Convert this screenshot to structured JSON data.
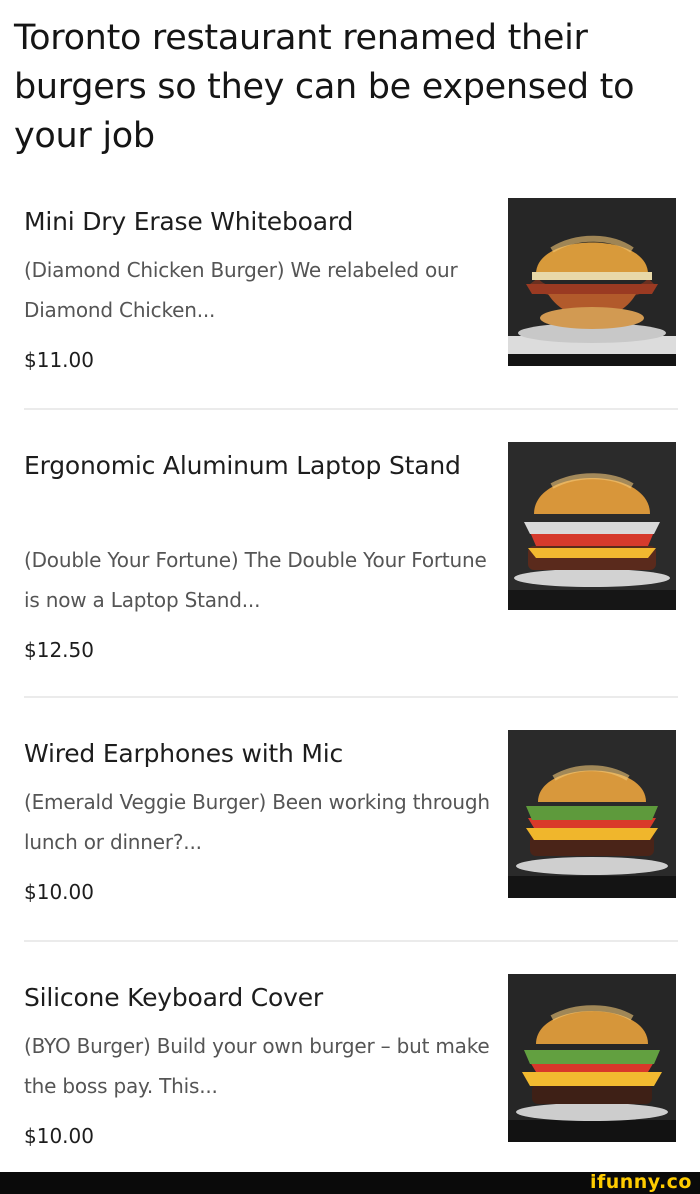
{
  "headline": "Toronto restaurant renamed their burgers so they can be expensed to your job",
  "items": [
    {
      "name": "Mini Dry Erase Whiteboard",
      "description": "(Diamond Chicken Burger) We relabeled our Diamond Chicken...",
      "price": "$11.00",
      "image_icon": "burger-photo-icon"
    },
    {
      "name": "Ergonomic Aluminum Laptop Stand",
      "description": "(Double Your Fortune) The Double Your Fortune is now a Laptop Stand...",
      "price": "$12.50",
      "image_icon": "burger-photo-icon"
    },
    {
      "name": "Wired Earphones with Mic",
      "description": "(Emerald Veggie Burger) Been working through lunch or dinner?...",
      "price": "$10.00",
      "image_icon": "burger-photo-icon"
    },
    {
      "name": "Silicone Keyboard Cover",
      "description": "(BYO Burger) Build your own burger – but make the boss pay. This...",
      "price": "$10.00",
      "image_icon": "burger-photo-icon"
    }
  ],
  "watermark": "ifunny.co",
  "colors": {
    "watermark": "#ffcc00",
    "footer": "#0a0a0a",
    "divider": "#ebebeb"
  }
}
